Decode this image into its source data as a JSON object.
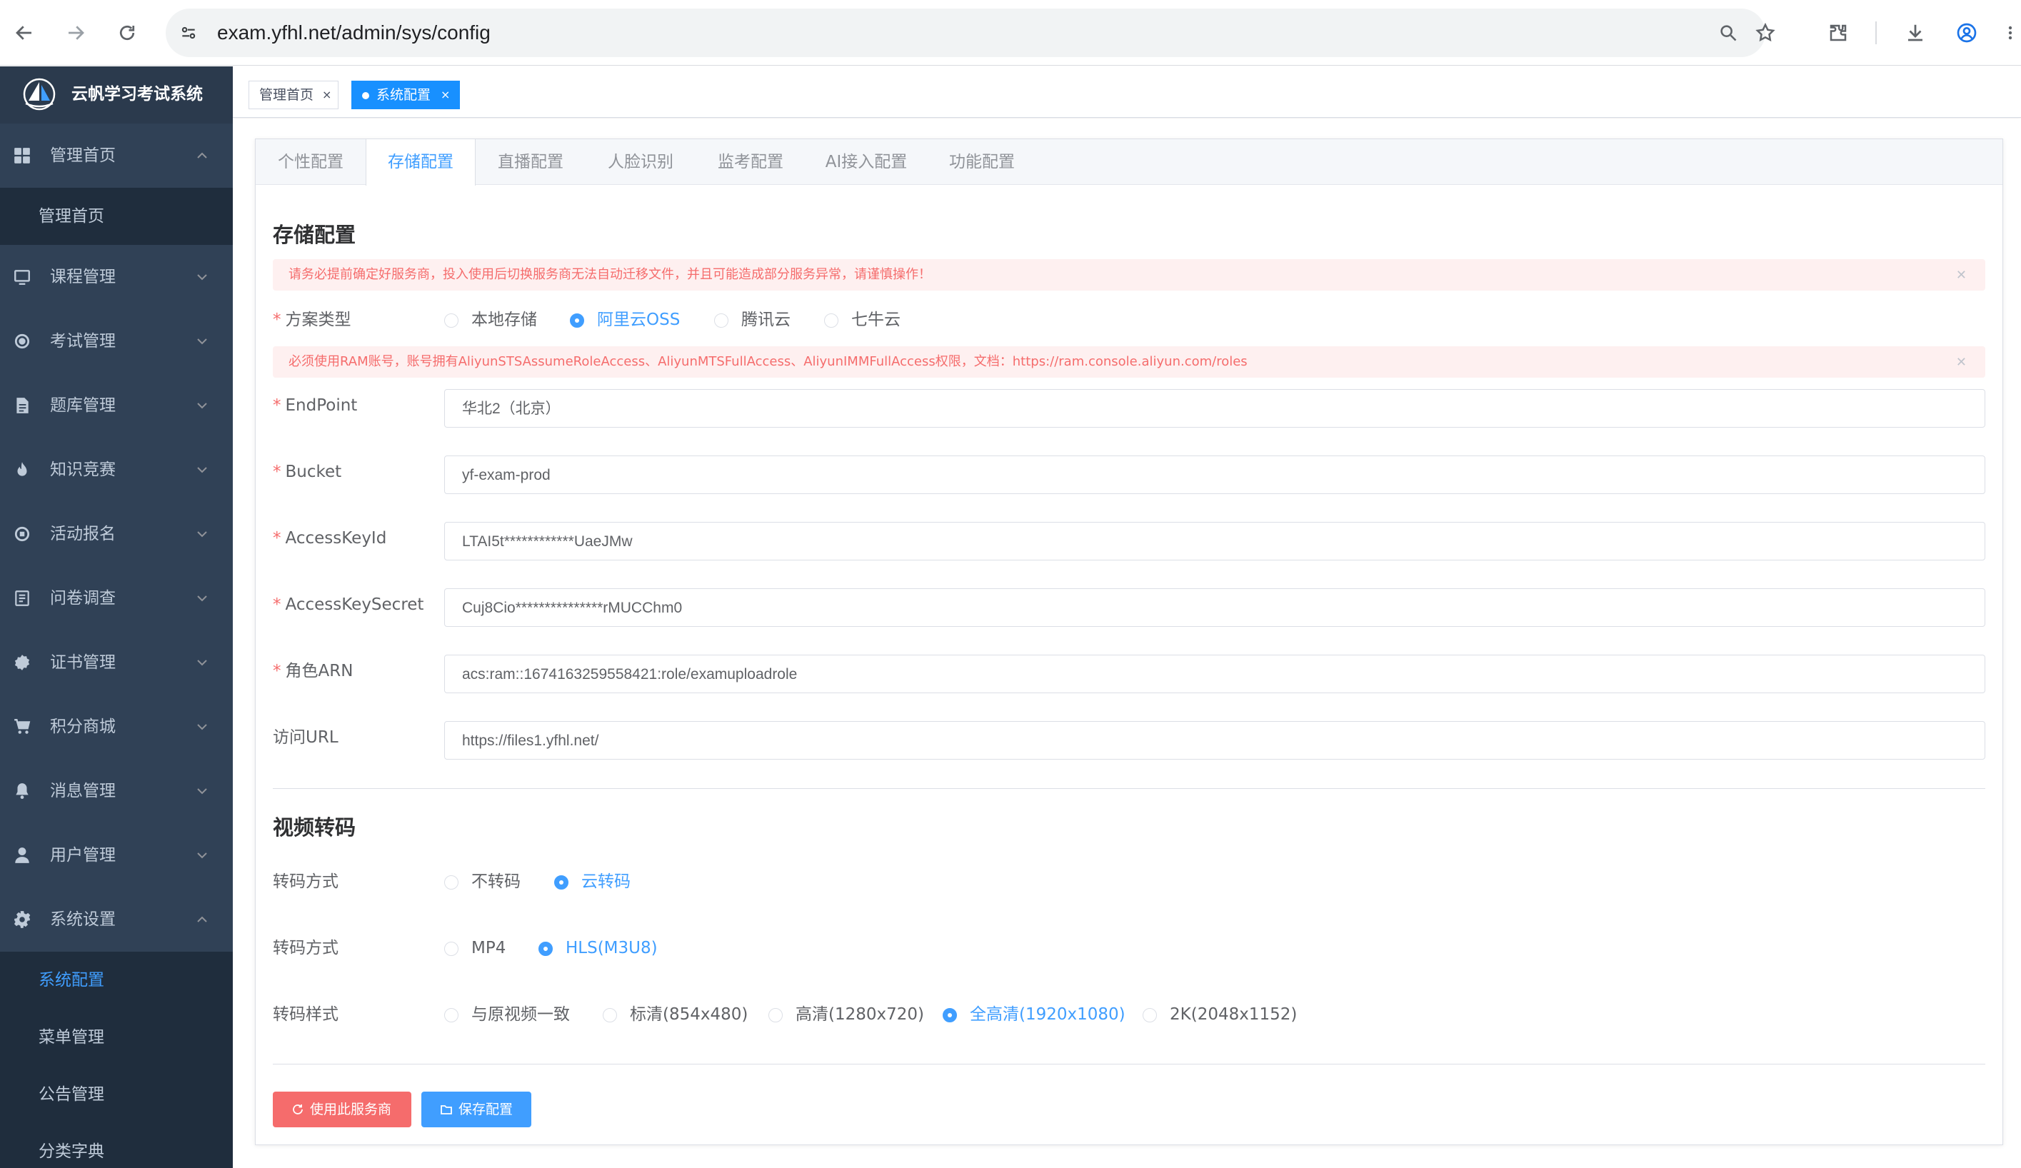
{
  "browser": {
    "url": "exam.yfhl.net/admin/sys/config"
  },
  "sidebar": {
    "brand": "云帆学习考试系统",
    "menu": [
      {
        "label": "管理首页",
        "icon": "dashboard-icon",
        "expanded": true
      },
      {
        "label": "课程管理",
        "icon": "course-icon"
      },
      {
        "label": "考试管理",
        "icon": "exam-icon"
      },
      {
        "label": "题库管理",
        "icon": "question-bank-icon"
      },
      {
        "label": "知识竞赛",
        "icon": "fire-icon"
      },
      {
        "label": "活动报名",
        "icon": "activity-icon"
      },
      {
        "label": "问卷调查",
        "icon": "survey-icon"
      },
      {
        "label": "证书管理",
        "icon": "certificate-icon"
      },
      {
        "label": "积分商城",
        "icon": "cart-icon"
      },
      {
        "label": "消息管理",
        "icon": "bell-icon"
      },
      {
        "label": "用户管理",
        "icon": "user-icon"
      },
      {
        "label": "系统设置",
        "icon": "gear-icon",
        "expanded": true
      }
    ],
    "home_sub": [
      "管理首页"
    ],
    "settings_sub": [
      "系统配置",
      "菜单管理",
      "公告管理",
      "分类字典"
    ],
    "active_sub": "系统配置"
  },
  "tags": [
    {
      "label": "管理首页",
      "active": false
    },
    {
      "label": "系统配置",
      "active": true
    }
  ],
  "tabs": [
    "个性配置",
    "存储配置",
    "直播配置",
    "人脸识别",
    "监考配置",
    "AI接入配置",
    "功能配置"
  ],
  "active_tab": "存储配置",
  "storage": {
    "title": "存储配置",
    "warning": "请务必提前确定好服务商，投入使用后切换服务商无法自动迁移文件，并且可能造成部分服务异常，请谨慎操作！",
    "scheme_label": "方案类型",
    "scheme_options": [
      "本地存储",
      "阿里云OSS",
      "腾讯云",
      "七牛云"
    ],
    "scheme_selected": "阿里云OSS",
    "ram_warning": "必须使用RAM账号，账号拥有AliyunSTSAssumeRoleAccess、AliyunMTSFullAccess、AliyunIMMFullAccess权限，文档：https://ram.console.aliyun.com/roles",
    "fields": [
      {
        "label": "EndPoint",
        "value": "华北2（北京）",
        "required": true
      },
      {
        "label": "Bucket",
        "value": "yf-exam-prod",
        "required": true
      },
      {
        "label": "AccessKeyId",
        "value": "LTAI5t************UaeJMw",
        "required": true
      },
      {
        "label": "AccessKeySecret",
        "value": "Cuj8Cio***************rMUCChm0",
        "required": true
      },
      {
        "label": "角色ARN",
        "value": "acs:ram::1674163259558421:role/examuploadrole",
        "required": true
      },
      {
        "label": "访问URL",
        "value": "https://files1.yfhl.net/",
        "required": false
      }
    ]
  },
  "video": {
    "title": "视频转码",
    "rows": [
      {
        "label": "转码方式",
        "options": [
          "不转码",
          "云转码"
        ],
        "selected": "云转码"
      },
      {
        "label": "转码方式",
        "options": [
          "MP4",
          "HLS(M3U8)"
        ],
        "selected": "HLS(M3U8)"
      },
      {
        "label": "转码样式",
        "options": [
          "与原视频一致",
          "标清(854x480)",
          "高清(1280x720)",
          "全高清(1920x1080)",
          "2K(2048x1152)"
        ],
        "selected": "全高清(1920x1080)"
      }
    ]
  },
  "buttons": {
    "use_provider": "使用此服务商",
    "save": "保存配置"
  },
  "colors": {
    "sidebar_bg": "#304156",
    "submenu_bg": "#1f2d3d",
    "primary": "#409eff",
    "danger": "#f56c6c",
    "alert_bg": "#fef0f0"
  }
}
